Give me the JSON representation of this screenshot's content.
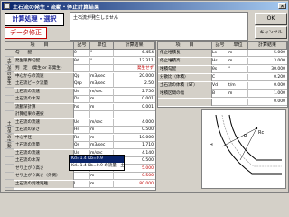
{
  "window": {
    "title": "土石流の発生・流動・停止計算結果"
  },
  "buttons": {
    "calc": "計算処理・選択",
    "data": "データ修正",
    "ok": "OK",
    "cancel": "キャンセル"
  },
  "message": "土石流が発生しません",
  "table": {
    "headers": [
      "項　　目",
      "記号",
      "単位",
      "計算結果"
    ],
    "sidebar": [
      "土石流の発生",
      "土石流の流動"
    ],
    "rows": [
      {
        "item": "勾　　配",
        "sym": "θ",
        "unit": "°",
        "val": "6.454"
      },
      {
        "item": "発生限界勾配",
        "sym": "θd",
        "unit": "°",
        "val": "12.311"
      },
      {
        "item": "判　定　(発生 or 非発生)",
        "sym": "",
        "unit": "",
        "val": "発生せず",
        "red": true
      },
      {
        "item": "中心からの流速",
        "sym": "Qp",
        "unit": "m3/sec",
        "val": "20.000"
      },
      {
        "item": "土石流ピーク流量",
        "sym": "Qsp",
        "unit": "m3/sec",
        "val": "2.50"
      },
      {
        "item": "土石流の流速",
        "sym": "Us",
        "unit": "m/sec",
        "val": "2.750"
      },
      {
        "item": "土石流の水深",
        "sym": "Dr",
        "unit": "m",
        "val": "0.001"
      },
      {
        "item": "流動深計算",
        "sym": "hs",
        "unit": "m",
        "val": "0.001"
      },
      {
        "item": "計算結果の選択",
        "sym": "",
        "unit": "",
        "val": ""
      },
      {
        "item": "土石流の流速",
        "sym": "Ue",
        "unit": "m/sec",
        "val": "4.000"
      },
      {
        "item": "土石流の深さ",
        "sym": "Hs",
        "unit": "m",
        "val": "0.500"
      },
      {
        "item": "中心半径",
        "sym": "Rc",
        "unit": "m",
        "val": "10.000"
      },
      {
        "item": "土石流の流量",
        "sym": "Qs",
        "unit": "m3/sec",
        "val": "1.710"
      },
      {
        "item": "土石流の流速",
        "sym": "Us",
        "unit": "m/sec",
        "val": "4.140"
      },
      {
        "item": "土石流の水深",
        "sym": "Hs",
        "unit": "m",
        "val": "0.500"
      },
      {
        "item": "せり上がり高さ",
        "sym": "Δh",
        "unit": "m",
        "val": "5.000",
        "red": true
      },
      {
        "item": "せり上がり高さ（外側）",
        "sym": "",
        "unit": "m",
        "val": "0.500",
        "red": true
      },
      {
        "item": "土石流の到達距離",
        "sym": "L",
        "unit": "m",
        "val": "80.000",
        "red": true
      }
    ],
    "dropdown": [
      "Kd=1.4 Kb=0.9",
      "Kd=1.4 Kb=0.9 の流量・土石流"
    ]
  },
  "right_table": {
    "headers": [
      "項　　目",
      "記号",
      "単位",
      "計算結果"
    ],
    "rows": [
      {
        "item": "停止堆積長",
        "sym": "Ls",
        "unit": "m",
        "val": "5.000"
      },
      {
        "item": "停止堆積高",
        "sym": "Hs",
        "unit": "m",
        "val": "3.000"
      },
      {
        "item": "堆積勾配",
        "sym": "θs",
        "unit": "°",
        "val": "30.000"
      },
      {
        "item": "分散比（体積）",
        "sym": "C",
        "unit": "",
        "val": "0.200"
      },
      {
        "item": "土石流の体積（ST）",
        "sym": "Vd",
        "unit": "t/m",
        "val": "0.000"
      },
      {
        "item": "堆積区間の幅",
        "sym": "B",
        "unit": "m",
        "val": "1.000"
      },
      {
        "item": "",
        "sym": "",
        "unit": "",
        "val": "0.000"
      }
    ]
  },
  "drawing": {
    "labels": [
      "H",
      "R",
      "Rc"
    ]
  }
}
